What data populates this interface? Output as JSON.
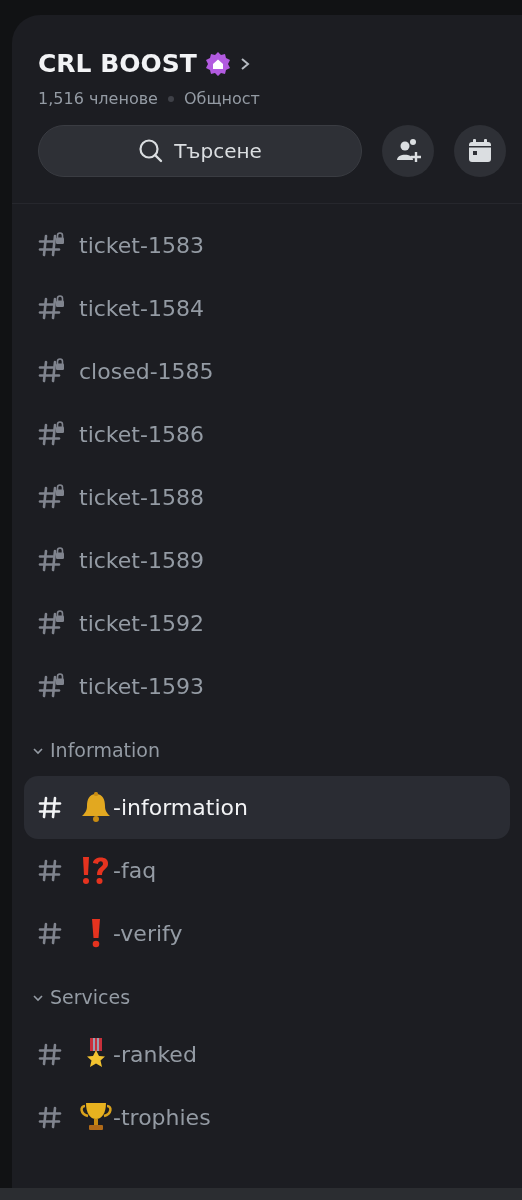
{
  "server": {
    "name": "CRL BOOST",
    "members": "1,516 членове",
    "type": "Общност"
  },
  "search": {
    "label": "Търсене"
  },
  "channels": [
    {
      "name": "ticket-1583",
      "kind": "locked",
      "selected": false
    },
    {
      "name": "ticket-1584",
      "kind": "locked",
      "selected": false
    },
    {
      "name": "closed-1585",
      "kind": "locked",
      "selected": false
    },
    {
      "name": "ticket-1586",
      "kind": "locked",
      "selected": false
    },
    {
      "name": "ticket-1588",
      "kind": "locked",
      "selected": false
    },
    {
      "name": "ticket-1589",
      "kind": "locked",
      "selected": false
    },
    {
      "name": "ticket-1592",
      "kind": "locked",
      "selected": false
    },
    {
      "name": "ticket-1593",
      "kind": "locked",
      "selected": false
    }
  ],
  "categories": [
    {
      "name": "Information",
      "expanded": true,
      "channels": [
        {
          "name": "-information",
          "kind": "bell",
          "selected": true
        },
        {
          "name": "-faq",
          "kind": "interrobang",
          "selected": false
        },
        {
          "name": "-verify",
          "kind": "exclamation",
          "selected": false
        }
      ]
    },
    {
      "name": "Services",
      "expanded": true,
      "channels": [
        {
          "name": "-ranked",
          "kind": "medal",
          "selected": false
        },
        {
          "name": "-trophies",
          "kind": "trophy",
          "selected": false
        }
      ]
    }
  ]
}
